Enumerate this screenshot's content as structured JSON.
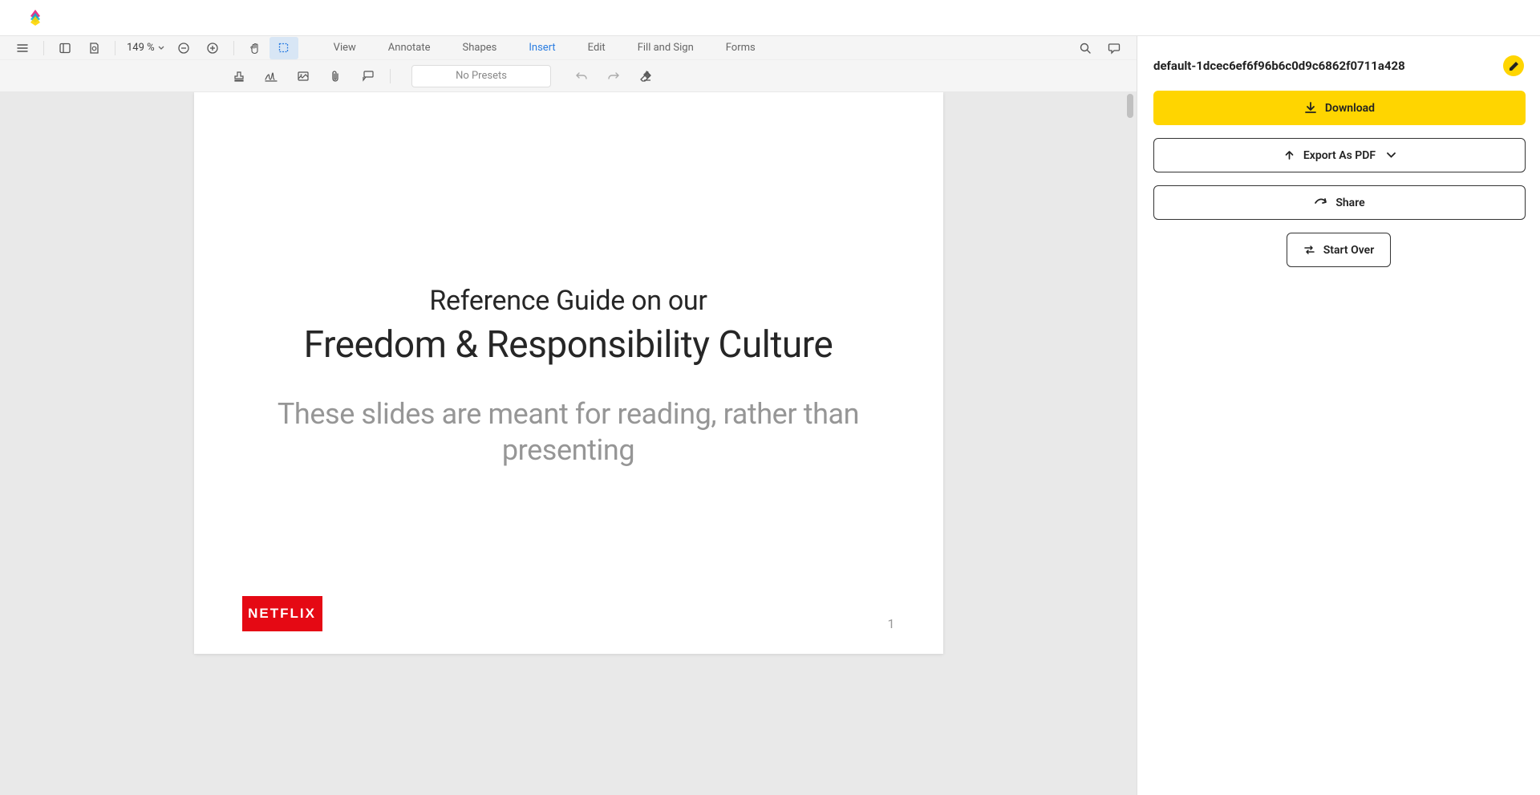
{
  "toolbar": {
    "zoom": "149 %",
    "tabs": [
      "View",
      "Annotate",
      "Shapes",
      "Insert",
      "Edit",
      "Fill and Sign",
      "Forms"
    ],
    "active_tab_index": 3,
    "presets": "No Presets"
  },
  "document": {
    "title_small": "Reference Guide on our",
    "title_large": "Freedom & Responsibility Culture",
    "subtitle": "These slides are meant for reading, rather than presenting",
    "logo_text": "NETFLIX",
    "page_number": "1"
  },
  "sidebar": {
    "filename": "default-1dcec6ef6f96b6c0d9c6862f0711a428",
    "download": "Download",
    "export": "Export As PDF",
    "share": "Share",
    "start_over": "Start Over"
  }
}
